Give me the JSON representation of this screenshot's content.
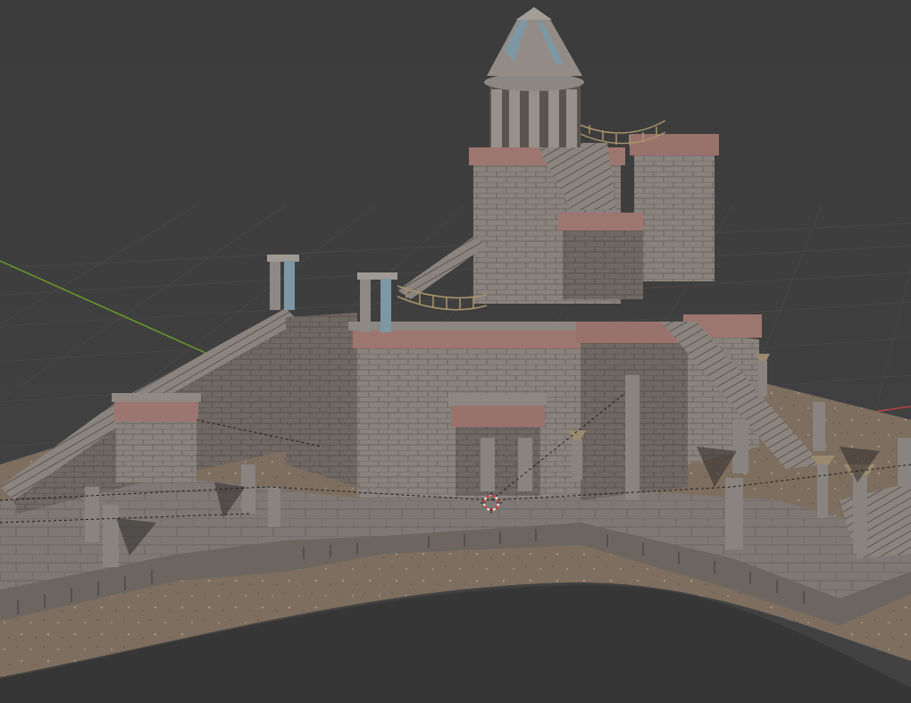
{
  "viewport": {
    "background_color": "#3d3d3d",
    "grid_color": "#4a4a4a",
    "x_axis_color": "#b34545",
    "y_axis_color": "#6a9a2a"
  },
  "scene": {
    "model": "stone-temple",
    "ground_color": "#7a6b5c",
    "stone_color": "#8c8580",
    "trim_color": "#a27a72",
    "accent_color": "#7a9aa8"
  },
  "overlays": {
    "cursor_3d_icon": "3d-cursor-icon"
  }
}
